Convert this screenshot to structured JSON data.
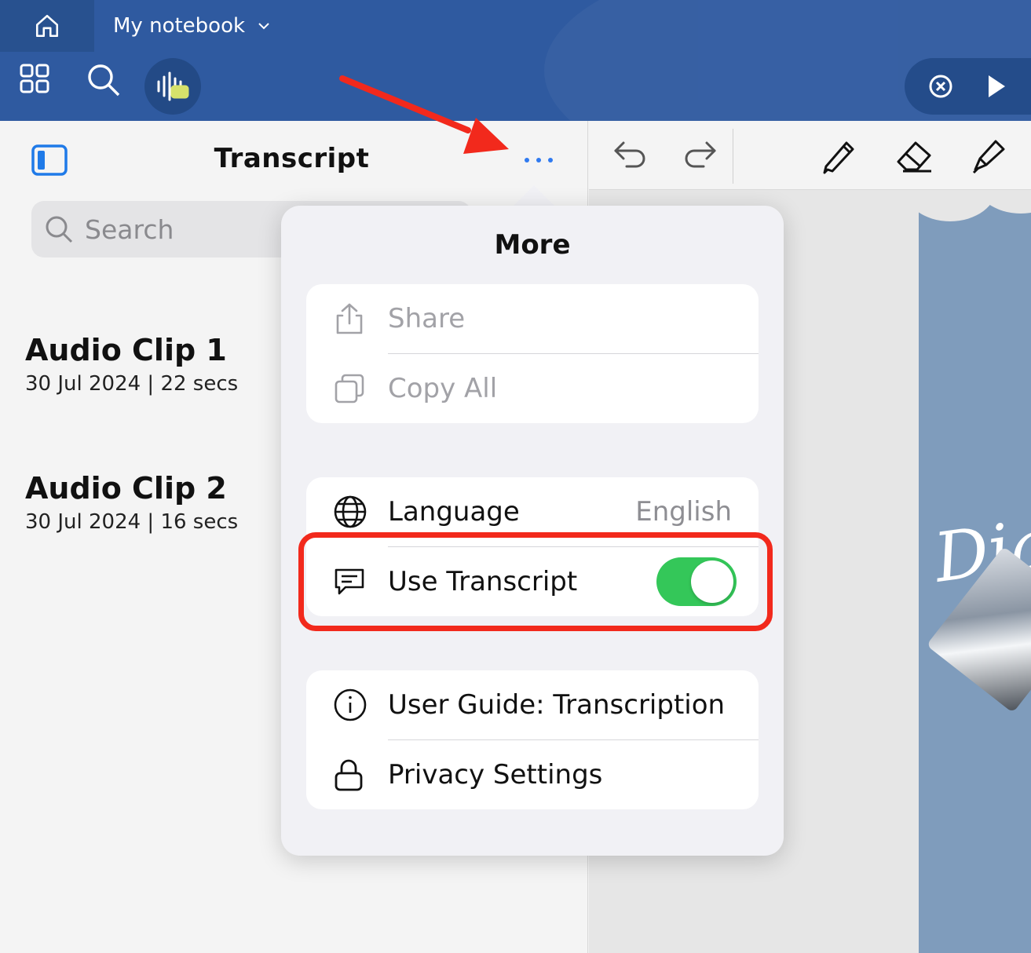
{
  "app": {
    "notebook_title": "My notebook"
  },
  "sidebar": {
    "title": "Transcript",
    "search_placeholder": "Search",
    "clips": [
      {
        "name": "Audio Clip 1",
        "meta": "30 Jul 2024 | 22 secs"
      },
      {
        "name": "Audio Clip 2",
        "meta": "30 Jul 2024 | 16 secs"
      }
    ]
  },
  "popover": {
    "title": "More",
    "group1": [
      {
        "label": "Share",
        "icon": "share-icon",
        "disabled": true
      },
      {
        "label": "Copy All",
        "icon": "copy-icon",
        "disabled": true
      }
    ],
    "group2": {
      "language_label": "Language",
      "language_value": "English",
      "transcript_label": "Use Transcript",
      "transcript_on": true
    },
    "group3": [
      {
        "label": "User Guide: Transcription",
        "icon": "info-icon"
      },
      {
        "label": "Privacy Settings",
        "icon": "lock-icon"
      }
    ]
  },
  "canvas": {
    "page_text": "Dia"
  },
  "colors": {
    "app_bar": "#2f5aa0",
    "accent_blue": "#2f7af0",
    "toggle_on": "#34c759",
    "annotation_red": "#f2291c"
  }
}
